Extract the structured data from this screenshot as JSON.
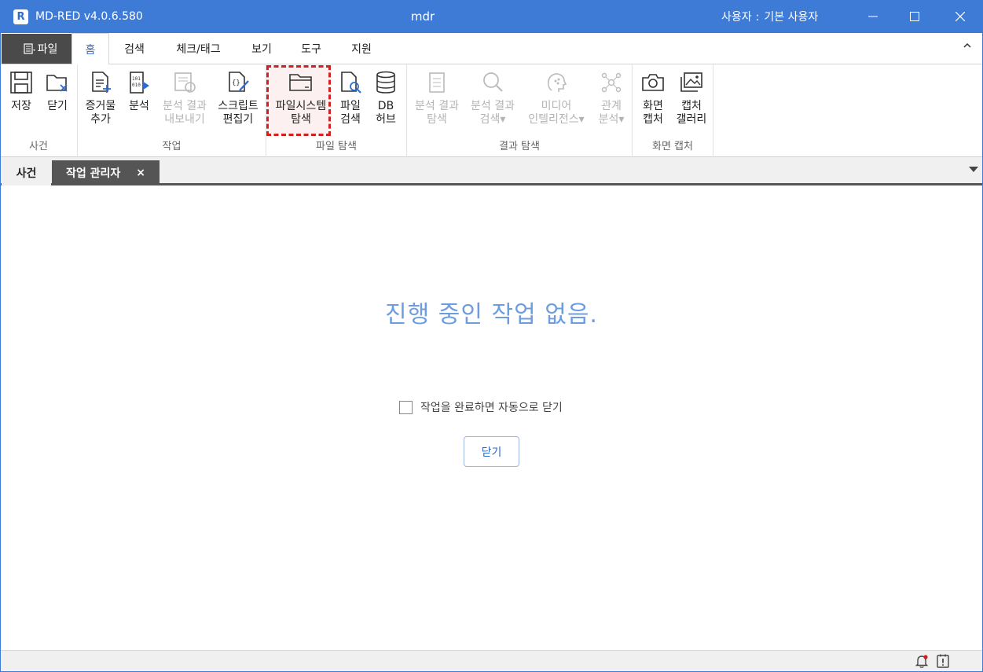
{
  "window": {
    "app_logo": "R",
    "app_name": "MD-RED v4.0.6.580",
    "doc_title": "mdr",
    "user_prefix": "사용자",
    "user_sep": ":",
    "user_name": "기본 사용자",
    "buttons": [
      "minimize-icon",
      "maximize-icon",
      "close-icon"
    ]
  },
  "menu": {
    "file_label": "파일",
    "tabs": [
      {
        "label": "홈",
        "active": true
      },
      {
        "label": "검색"
      },
      {
        "label": "체크/태그"
      },
      {
        "label": "보기"
      },
      {
        "label": "도구"
      },
      {
        "label": "지원"
      }
    ],
    "collapse_icon": "chevron-up-icon"
  },
  "ribbon": {
    "groups": [
      {
        "label": "사건",
        "buttons": [
          {
            "label": "저장",
            "icon": "save-icon"
          },
          {
            "label": "닫기",
            "icon": "close-case-icon"
          }
        ]
      },
      {
        "label": "작업",
        "buttons": [
          {
            "label": "증거물\n추가",
            "icon": "add-evidence-icon"
          },
          {
            "label": "분석",
            "icon": "analyze-icon"
          },
          {
            "label": "분석 결과\n내보내기",
            "icon": "export-results-icon",
            "disabled": true
          },
          {
            "label": "스크립트\n편집기",
            "icon": "script-editor-icon"
          }
        ]
      },
      {
        "label": "파일 탐색",
        "buttons": [
          {
            "label": "파일시스템\n탐색",
            "icon": "folder-icon",
            "highlighted": true
          },
          {
            "label": "파일\n검색",
            "icon": "file-search-icon"
          },
          {
            "label": "DB\n허브",
            "icon": "database-icon"
          }
        ]
      },
      {
        "label": "결과 탐색",
        "buttons": [
          {
            "label": "분석 결과\n탐색",
            "icon": "results-list-icon",
            "disabled": true
          },
          {
            "label": "분석 결과\n검색▾",
            "icon": "search-icon",
            "disabled": true
          },
          {
            "label": "미디어\n인텔리전스▾",
            "icon": "media-intelligence-icon",
            "disabled": true
          },
          {
            "label": "관계\n분석▾",
            "icon": "relation-graph-icon",
            "disabled": true
          }
        ]
      },
      {
        "label": "화면 캡처",
        "buttons": [
          {
            "label": "화면\n캡처",
            "icon": "camera-icon"
          },
          {
            "label": "캡처\n갤러리",
            "icon": "gallery-icon"
          }
        ]
      }
    ]
  },
  "doc_tabs": {
    "tabs": [
      {
        "label": "사건"
      },
      {
        "label": "작업 관리자",
        "active": true,
        "close": "×"
      }
    ]
  },
  "main": {
    "empty_message": "진행 중인 작업 없음.",
    "auto_close_label": "작업을 완료하면 자동으로 닫기",
    "auto_close_checked": false,
    "close_button": "닫기"
  },
  "status": {
    "icons": [
      "notification-bell-icon",
      "alert-icon"
    ]
  },
  "colors": {
    "titlebar": "#3d7bd6",
    "accent": "#2e6bd0",
    "empty_message": "#6c9de0",
    "highlight": "#d21f1f"
  }
}
